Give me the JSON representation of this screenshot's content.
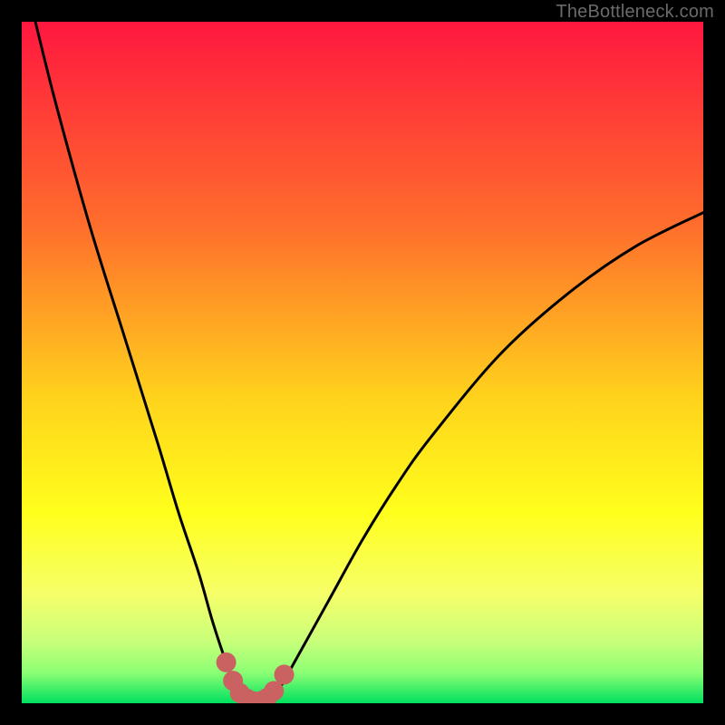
{
  "watermark": "TheBottleneck.com",
  "colors": {
    "bg_black": "#000000",
    "grad_top": "#ff173f",
    "grad_mid1": "#ff6e2c",
    "grad_mid2": "#ffd21c",
    "grad_mid3": "#ffff1c",
    "grad_low1": "#f6ff6a",
    "grad_low2": "#c8ff7a",
    "grad_low3": "#8cff74",
    "grad_bottom": "#00e060",
    "curve_stroke": "#000000",
    "marker_fill": "#cb6262"
  },
  "chart_data": {
    "type": "line",
    "title": "",
    "xlabel": "",
    "ylabel": "",
    "xlim": [
      0,
      100
    ],
    "ylim": [
      0,
      100
    ],
    "series": [
      {
        "name": "bottleneck-curve",
        "x": [
          2,
          5,
          10,
          15,
          20,
          23,
          26,
          28,
          30,
          31.5,
          33,
          34,
          35,
          36,
          38,
          40,
          45,
          50,
          55,
          60,
          70,
          80,
          90,
          100
        ],
        "values": [
          100,
          88,
          70,
          54,
          38,
          28,
          19,
          12,
          6,
          2.5,
          0.7,
          0.3,
          0.3,
          0.8,
          2.5,
          6,
          15,
          24,
          32,
          39,
          51,
          60,
          67,
          72
        ]
      }
    ],
    "markers": {
      "name": "highlighted-range",
      "x": [
        30,
        31,
        32,
        33,
        34,
        35,
        36,
        37,
        38.5
      ],
      "values": [
        6,
        3.3,
        1.5,
        0.7,
        0.3,
        0.3,
        0.8,
        1.8,
        4.2
      ],
      "radius_px": 11
    }
  }
}
